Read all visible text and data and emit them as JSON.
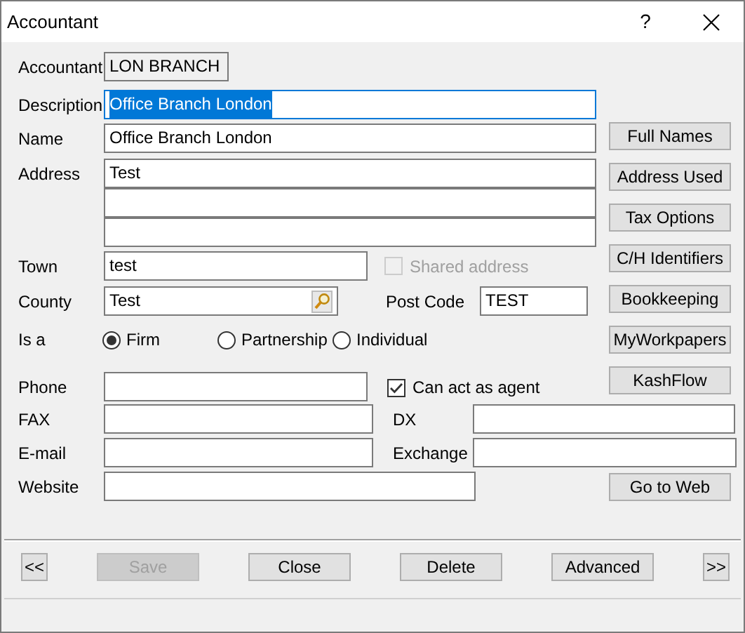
{
  "window": {
    "title": "Accountant",
    "help": "?"
  },
  "accountant": {
    "label": "Accountant",
    "value": "LON BRANCH"
  },
  "description": {
    "label": "Description",
    "value": "Office Branch London",
    "selected": true
  },
  "name": {
    "label": "Name",
    "value": "Office Branch London"
  },
  "address": {
    "label": "Address",
    "lines": [
      "Test"
    ]
  },
  "town": {
    "label": "Town",
    "value": "test"
  },
  "shared_address": {
    "label": "Shared address",
    "checked": false,
    "disabled": true
  },
  "county": {
    "label": "County",
    "value": "Test"
  },
  "post_code": {
    "label": "Post Code",
    "value": "TEST"
  },
  "is_a": {
    "label": "Is a",
    "options": [
      {
        "label": "Firm",
        "selected": true
      },
      {
        "label": "Partnership",
        "selected": false
      },
      {
        "label": "Individual",
        "selected": false
      }
    ]
  },
  "phone": {
    "label": "Phone"
  },
  "can_act_as_agent": {
    "label": "Can act as agent",
    "checked": true,
    "disabled": false
  },
  "fax": {
    "label": "FAX"
  },
  "dx": {
    "label": "DX"
  },
  "email": {
    "label": "E-mail"
  },
  "exchange": {
    "label": "Exchange"
  },
  "website": {
    "label": "Website"
  },
  "side_buttons": [
    {
      "label": "Full Names"
    },
    {
      "label": "Address Used"
    },
    {
      "label": "Tax Options"
    },
    {
      "label": "C/H Identifiers"
    },
    {
      "label": "Bookkeeping"
    },
    {
      "label": "MyWorkpapers"
    }
  ],
  "kashflow": {
    "label": "KashFlow"
  },
  "go_to_web": {
    "label": "Go to Web"
  },
  "footer_buttons": [
    {
      "label": "<<",
      "disabled": false
    },
    {
      "label": "Save",
      "disabled": true
    },
    {
      "label": "Close",
      "disabled": false
    },
    {
      "label": "Delete",
      "disabled": false
    },
    {
      "label": "Advanced",
      "disabled": false
    },
    {
      "label": ">>",
      "disabled": false
    }
  ]
}
